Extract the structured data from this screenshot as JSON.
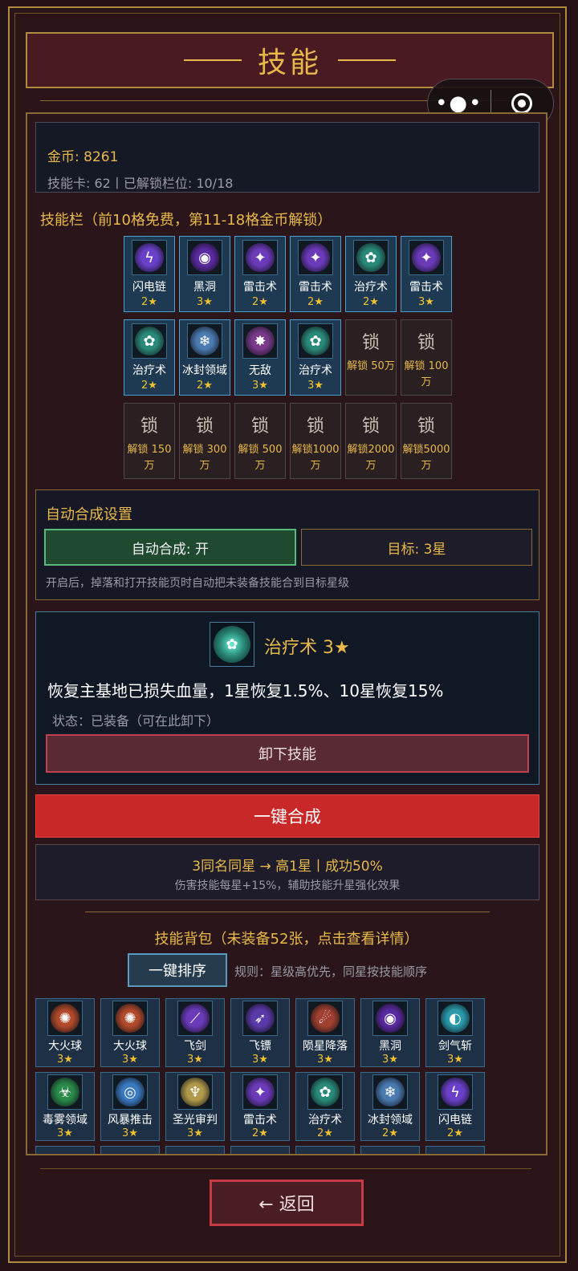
{
  "header": {
    "title": "技能"
  },
  "capsule": {
    "more_icon": "more-dots-icon",
    "close_icon": "target-circle-icon"
  },
  "info": {
    "gold": "金币: 8261",
    "cards": "技能卡: 62丨已解锁栏位: 10/18"
  },
  "skill_bar": {
    "title": "技能栏（前10格免费，第11-18格金币解锁）",
    "slots": [
      {
        "name": "闪电链",
        "stars": "2★",
        "icon": "lightning-icon",
        "color": "#6a40c8"
      },
      {
        "name": "黑洞",
        "stars": "3★",
        "icon": "black-hole-icon",
        "color": "#5a2aa0"
      },
      {
        "name": "雷击术",
        "stars": "2★",
        "icon": "thunder-icon",
        "color": "#6a3ab8"
      },
      {
        "name": "雷击术",
        "stars": "2★",
        "icon": "thunder-icon",
        "color": "#6a3ab8"
      },
      {
        "name": "治疗术",
        "stars": "2★",
        "icon": "heal-icon",
        "color": "#2a8a7a"
      },
      {
        "name": "雷击术",
        "stars": "3★",
        "icon": "thunder-icon",
        "color": "#6a3ab8"
      },
      {
        "name": "治疗术",
        "stars": "2★",
        "icon": "heal-icon",
        "color": "#2a8a7a"
      },
      {
        "name": "冰封领域",
        "stars": "2★",
        "icon": "frost-icon",
        "color": "#4a7ab0"
      },
      {
        "name": "无敌",
        "stars": "3★",
        "icon": "invincible-icon",
        "color": "#7a3a8a"
      },
      {
        "name": "治疗术",
        "stars": "3★",
        "icon": "heal-icon",
        "color": "#2a8a7a"
      }
    ],
    "locked": [
      {
        "lock": "锁",
        "unlock": "解锁 50万"
      },
      {
        "lock": "锁",
        "unlock": "解锁 100万"
      },
      {
        "lock": "锁",
        "unlock": "解锁 150万"
      },
      {
        "lock": "锁",
        "unlock": "解锁 300万"
      },
      {
        "lock": "锁",
        "unlock": "解锁 500万"
      },
      {
        "lock": "锁",
        "unlock": "解锁1000万"
      },
      {
        "lock": "锁",
        "unlock": "解锁2000万"
      },
      {
        "lock": "锁",
        "unlock": "解锁5000万"
      }
    ]
  },
  "auto_merge": {
    "title": "自动合成设置",
    "toggle_label": "自动合成: 开",
    "target_label": "目标: 3星",
    "hint": "开启后，掉落和打开技能页时自动把未装备技能合到目标星级"
  },
  "detail": {
    "icon": "heal-icon",
    "name": "治疗术  3★",
    "desc": "恢复主基地已损失血量，1星恢复1.5%、10星恢复15%",
    "status": "状态：已装备（可在此卸下）",
    "unequip_label": "卸下技能"
  },
  "merge": {
    "button_label": "一键合成",
    "rule_main": "3同名同星 → 高1星丨成功50%",
    "rule_sub": "伤害技能每星+15%，辅助技能升星强化效果"
  },
  "bag": {
    "title": "技能背包（未装备52张，点击查看详情）",
    "sort_label": "一键排序",
    "sort_rule": "规则：星级高优先，同星按技能顺序",
    "items": [
      {
        "name": "大火球",
        "stars": "3★",
        "icon": "fireball-icon",
        "color": "#b04a2a"
      },
      {
        "name": "大火球",
        "stars": "3★",
        "icon": "fireball-icon",
        "color": "#b04a2a"
      },
      {
        "name": "飞剑",
        "stars": "3★",
        "icon": "flying-sword-icon",
        "color": "#6a3ab8"
      },
      {
        "name": "飞镖",
        "stars": "3★",
        "icon": "dart-icon",
        "color": "#5a3aa8"
      },
      {
        "name": "陨星降落",
        "stars": "3★",
        "icon": "meteor-icon",
        "color": "#a04030"
      },
      {
        "name": "黑洞",
        "stars": "3★",
        "icon": "black-hole-icon",
        "color": "#5a2aa0"
      },
      {
        "name": "剑气斩",
        "stars": "3★",
        "icon": "sword-wave-icon",
        "color": "#2a9aaa"
      },
      {
        "name": "毒雾领域",
        "stars": "3★",
        "icon": "poison-icon",
        "color": "#2a8a4a"
      },
      {
        "name": "风暴推击",
        "stars": "3★",
        "icon": "storm-icon",
        "color": "#3a7ac0"
      },
      {
        "name": "圣光审判",
        "stars": "3★",
        "icon": "holy-light-icon",
        "color": "#b09a4a"
      },
      {
        "name": "雷击术",
        "stars": "2★",
        "icon": "thunder-icon",
        "color": "#6a3ab8"
      },
      {
        "name": "治疗术",
        "stars": "2★",
        "icon": "heal-icon",
        "color": "#2a8a7a"
      },
      {
        "name": "冰封领域",
        "stars": "2★",
        "icon": "frost-icon",
        "color": "#4a7ab0"
      },
      {
        "name": "闪电链",
        "stars": "2★",
        "icon": "lightning-icon",
        "color": "#6a40c8"
      }
    ]
  },
  "footer": {
    "back_label": "← 返回"
  }
}
